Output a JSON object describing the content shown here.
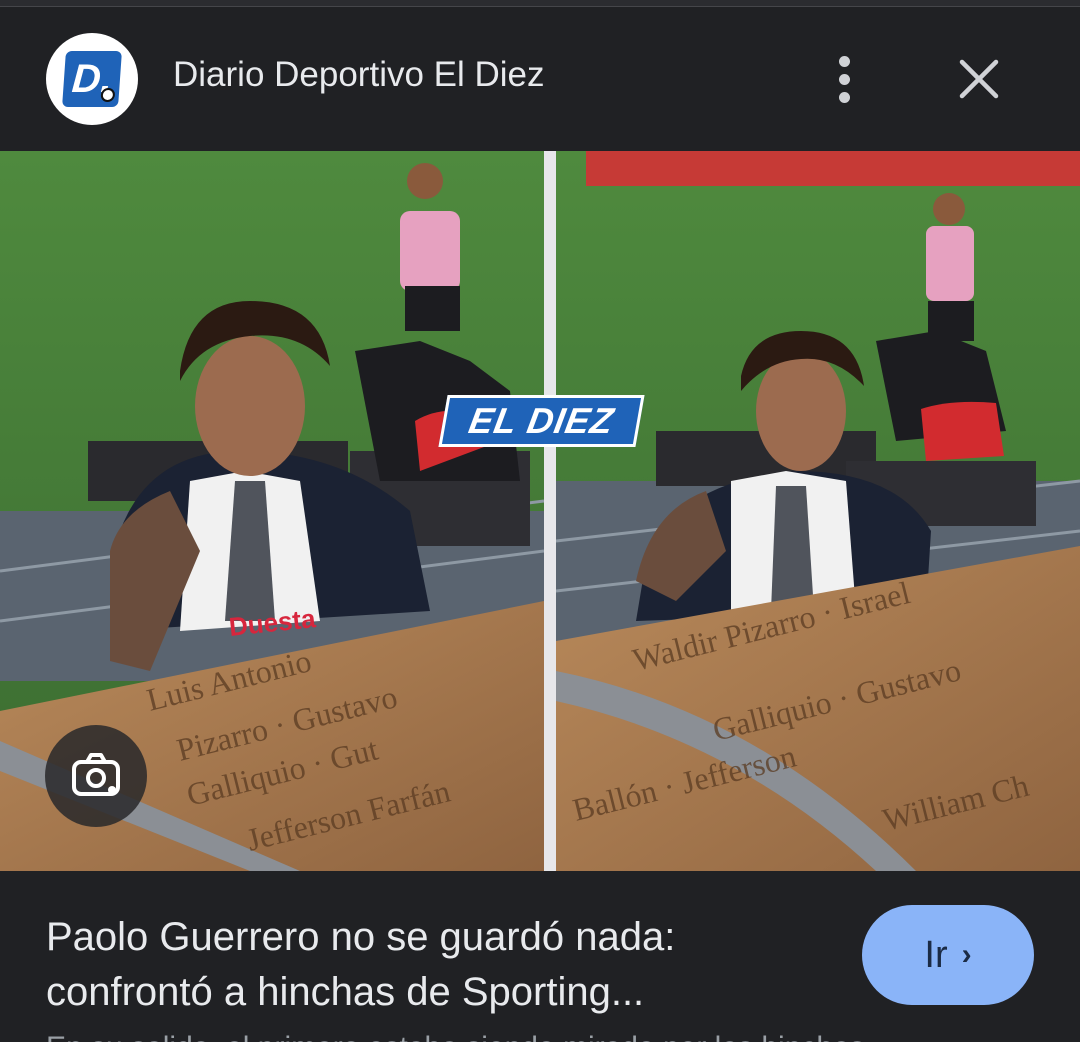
{
  "header": {
    "logo_letter": "D.",
    "source_title": "Diario Deportivo El Diez"
  },
  "media": {
    "watermark": "EL DIEZ",
    "shirt_sponsor": "Duesta"
  },
  "result": {
    "headline": "Paolo Guerrero no se guardó nada: confrontó a hinchas de Sporting...",
    "go_label": "Ir",
    "go_chevron": "›",
    "snippet": "En su salida, el primero estaba siendo mirado por los hinchas..."
  },
  "icons": {
    "more": "more-vert-icon",
    "close": "close-icon",
    "lens": "lens-camera-icon"
  },
  "colors": {
    "background": "#202124",
    "accent_button": "#8ab4f8",
    "text_primary": "#e8eaed",
    "text_secondary": "#9aa0a6"
  }
}
